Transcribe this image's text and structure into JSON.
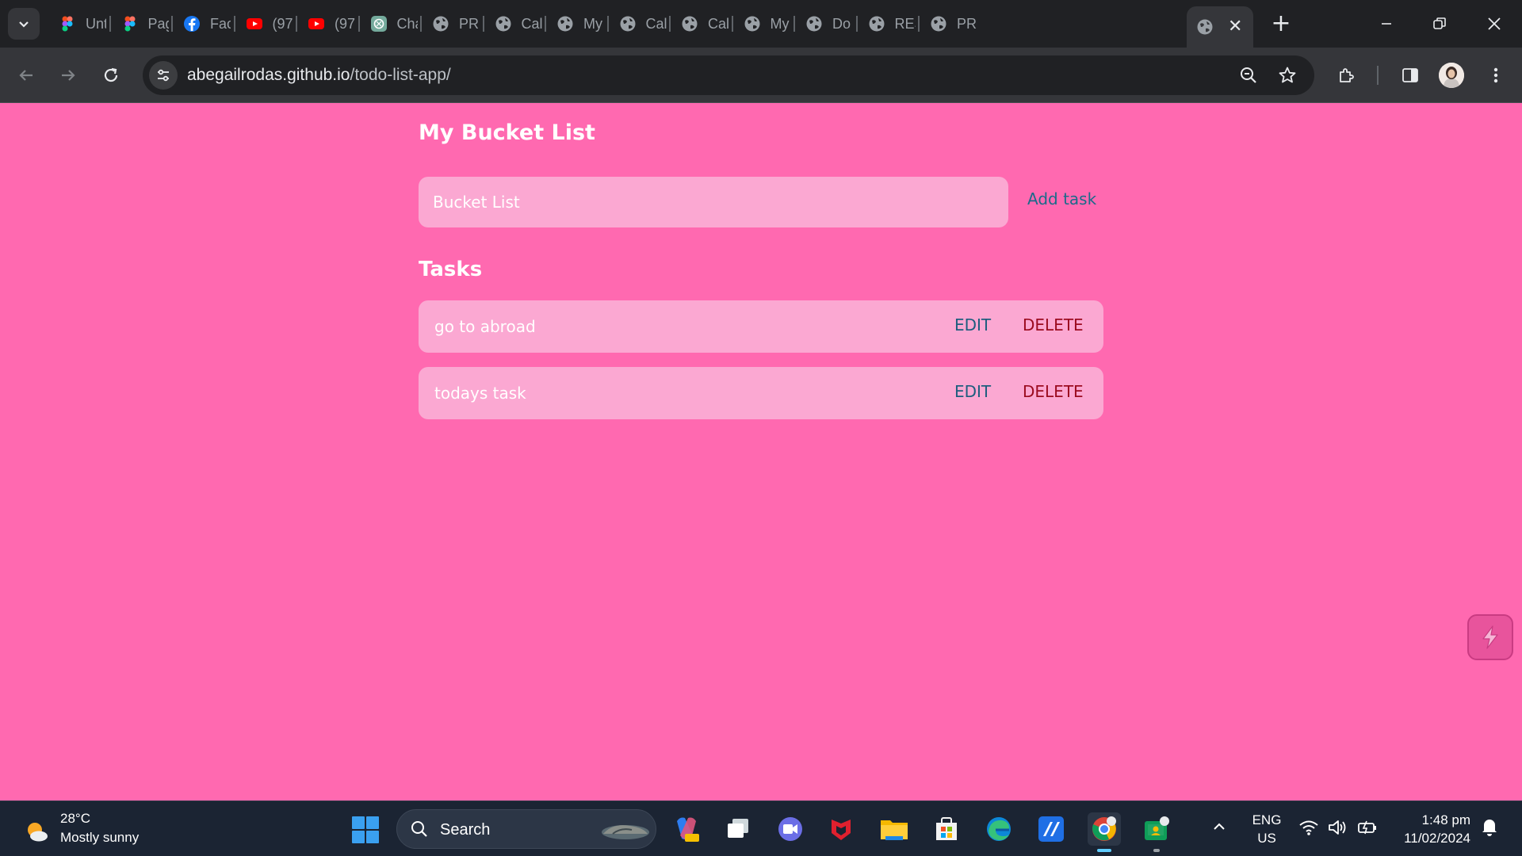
{
  "browser": {
    "tabs": [
      {
        "title": "Unt",
        "icon": "figma-icon"
      },
      {
        "title": "Pag",
        "icon": "figma-icon"
      },
      {
        "title": "Fac",
        "icon": "facebook-icon"
      },
      {
        "title": "(97",
        "icon": "youtube-icon"
      },
      {
        "title": "(97",
        "icon": "youtube-icon"
      },
      {
        "title": "Cha",
        "icon": "chatgpt-icon"
      },
      {
        "title": "PRI",
        "icon": "globe-icon"
      },
      {
        "title": "Cal",
        "icon": "globe-icon"
      },
      {
        "title": "My",
        "icon": "globe-icon"
      },
      {
        "title": "Cal",
        "icon": "globe-icon"
      },
      {
        "title": "Cal",
        "icon": "globe-icon"
      },
      {
        "title": "My",
        "icon": "globe-icon"
      },
      {
        "title": "Do",
        "icon": "globe-icon"
      },
      {
        "title": "RES",
        "icon": "globe-icon"
      },
      {
        "title": "PRI",
        "icon": "globe-icon"
      }
    ],
    "active_tab": {
      "icon": "globe-icon",
      "close": "✕"
    },
    "new_tab": "+",
    "url_host": "abegailrodas.github.io",
    "url_path": "/todo-list-app/"
  },
  "app": {
    "title": "My Bucket List",
    "input_placeholder": "Bucket List",
    "add_label": "Add task",
    "tasks_heading": "Tasks",
    "tasks": [
      {
        "text": "go to abroad",
        "edit": "EDIT",
        "delete": "DELETE"
      },
      {
        "text": "todays task",
        "edit": "EDIT",
        "delete": "DELETE"
      }
    ]
  },
  "taskbar": {
    "weather_temp": "28°C",
    "weather_condition": "Mostly sunny",
    "search_label": "Search",
    "lang_line1": "ENG",
    "lang_line2": "US",
    "time": "1:48 pm",
    "date": "11/02/2024"
  },
  "colors": {
    "page_bg": "#ff69b0",
    "card_bg": "#fba8d2",
    "edit": "#1d5d7e",
    "delete": "#9b0b1f"
  }
}
